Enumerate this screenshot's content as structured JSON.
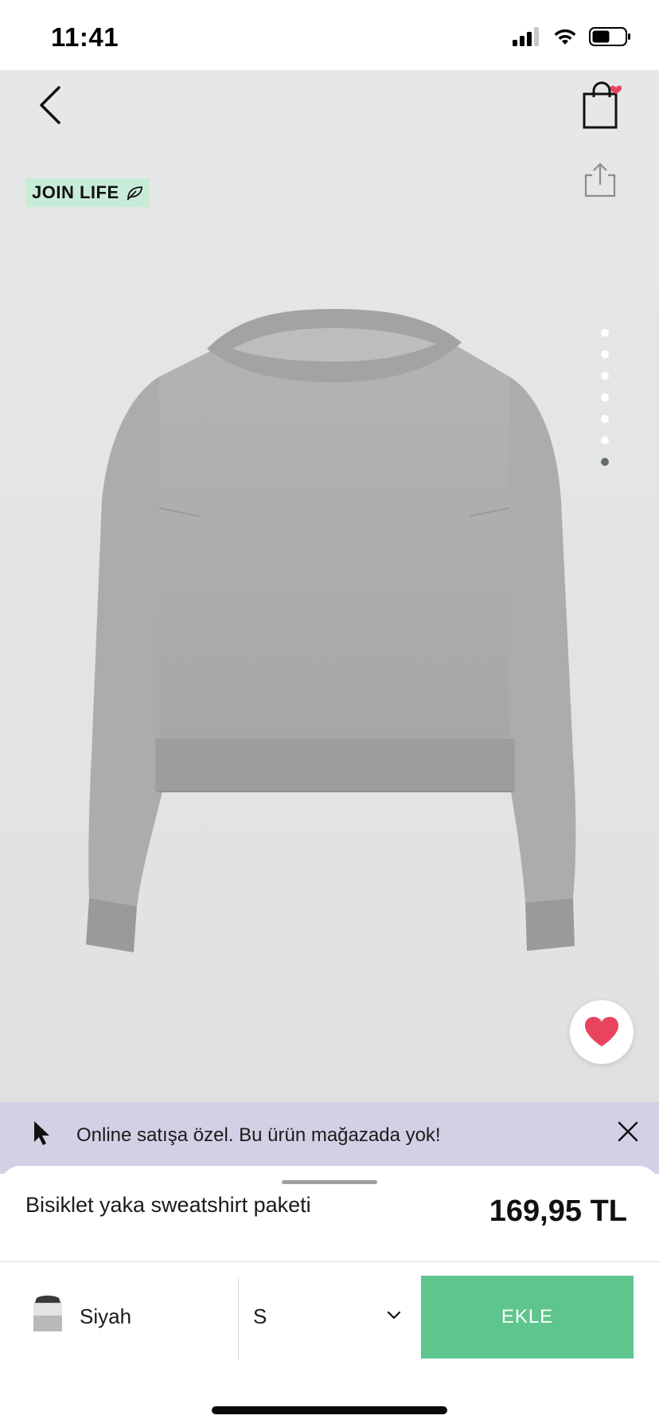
{
  "status_bar": {
    "time": "11:41"
  },
  "header": {
    "back_icon": "chevron-left-icon",
    "cart_icon": "shopping-bag-icon",
    "cart_badge_color": "#e8445f",
    "share_icon": "share-icon"
  },
  "badge": {
    "label": "JOIN LIFE",
    "icon": "leaf-icon",
    "background": "#c9ecd9"
  },
  "gallery": {
    "image_count": 7,
    "active_index": 6
  },
  "favorite": {
    "icon": "heart-icon",
    "color": "#e8445f"
  },
  "banner": {
    "text": "Online satışa özel. Bu ürün mağazada yok!",
    "icon": "cursor-icon",
    "close_icon": "close-icon",
    "background": "#d2d0e4"
  },
  "product": {
    "name": "Bisiklet yaka sweatshirt paketi",
    "price": "169,95 TL"
  },
  "purchase_bar": {
    "color_label": "Siyah",
    "size_value": "S",
    "add_label": "EKLE",
    "add_color": "#5dc58d"
  }
}
